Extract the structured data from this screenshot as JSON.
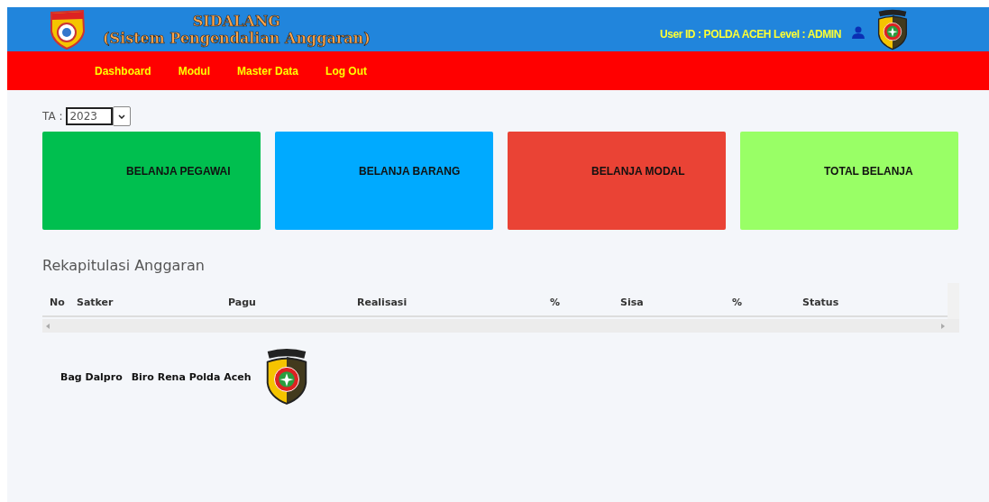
{
  "header": {
    "title": "SIDALANG",
    "subtitle": "(Sistem Pengendalian Anggaran)",
    "user_info": "User ID : POLDA ACEH Level : ADMIN"
  },
  "nav": [
    {
      "label": "Dashboard"
    },
    {
      "label": "Modul"
    },
    {
      "label": "Master Data"
    },
    {
      "label": "Log Out"
    }
  ],
  "year_filter": {
    "label": "TA :",
    "value": "2023"
  },
  "cards": [
    {
      "title": "BELANJA PEGAWAI",
      "color": "#00bf4f"
    },
    {
      "title": "BELANJA BARANG",
      "color": "#00aaff"
    },
    {
      "title": "BELANJA MODAL",
      "color": "#ea4335"
    },
    {
      "title": "TOTAL BELANJA",
      "color": "#99ff66"
    }
  ],
  "table": {
    "title": "Rekapitulasi Anggaran",
    "columns": [
      "No",
      "Satker",
      "Pagu",
      "Realisasi",
      "%",
      "Sisa",
      "%",
      "Status"
    ]
  },
  "footer": {
    "unit": "Bag Dalpro",
    "org": "Biro Rena Polda Aceh"
  }
}
